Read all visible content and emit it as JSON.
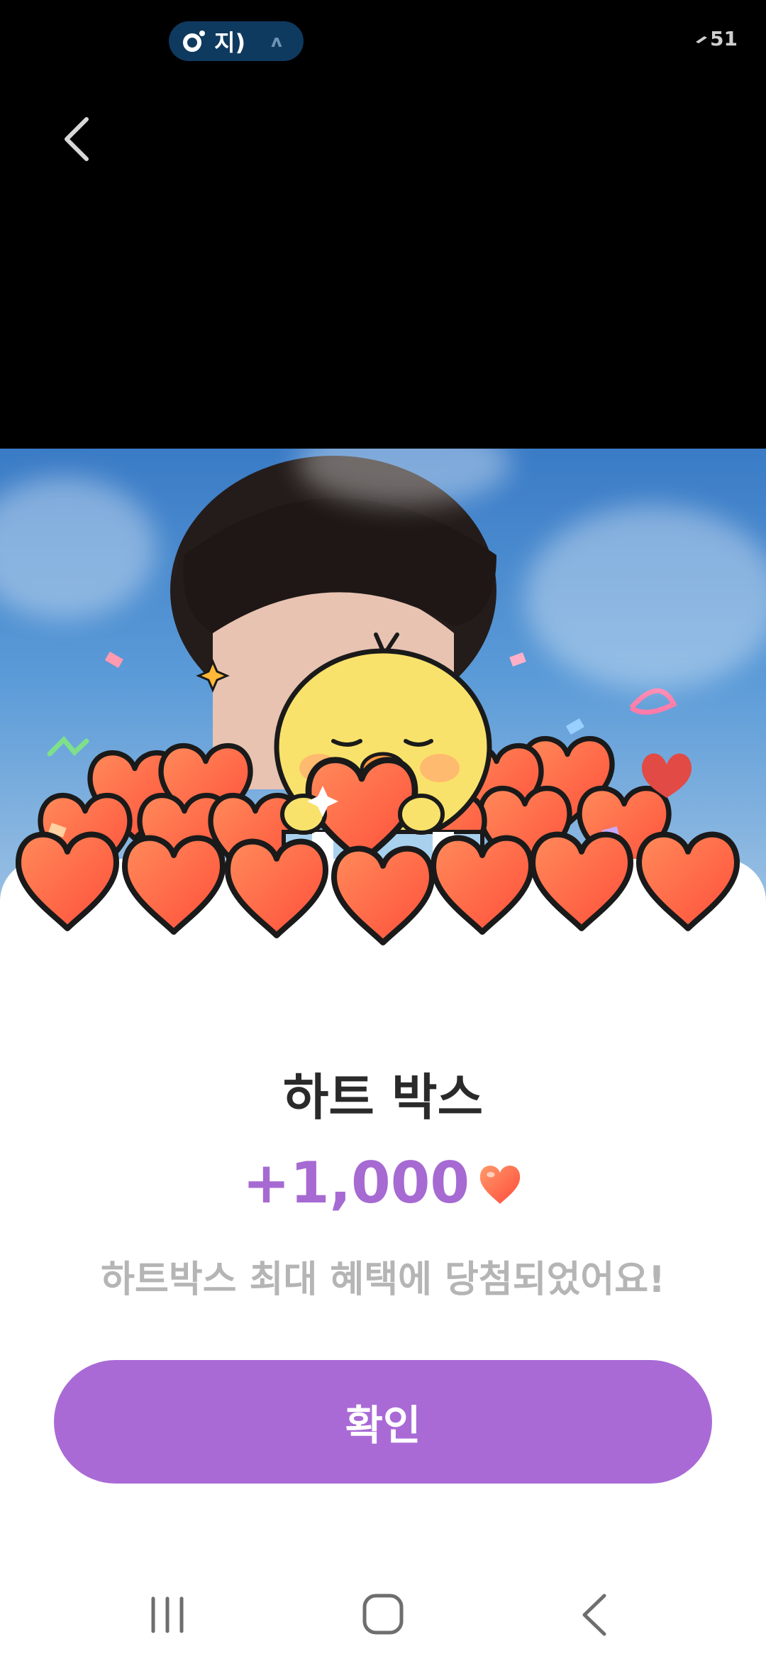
{
  "status_bar": {
    "pill_text": "지)",
    "pill_extra": "ʌ",
    "battery": "51"
  },
  "reward": {
    "title": "하트 박스",
    "amount": "+1,000",
    "message": "하트박스 최대 혜택에 당첨되었어요!",
    "confirm_label": "확인"
  },
  "colors": {
    "accent": "#a96ad6",
    "amount": "#a66ad2",
    "heart": "#ff6a45"
  },
  "icons": {
    "back": "chevron-left-icon",
    "heart": "heart-icon",
    "nav_recents": "recents-icon",
    "nav_home": "home-icon",
    "nav_back": "back-icon"
  }
}
